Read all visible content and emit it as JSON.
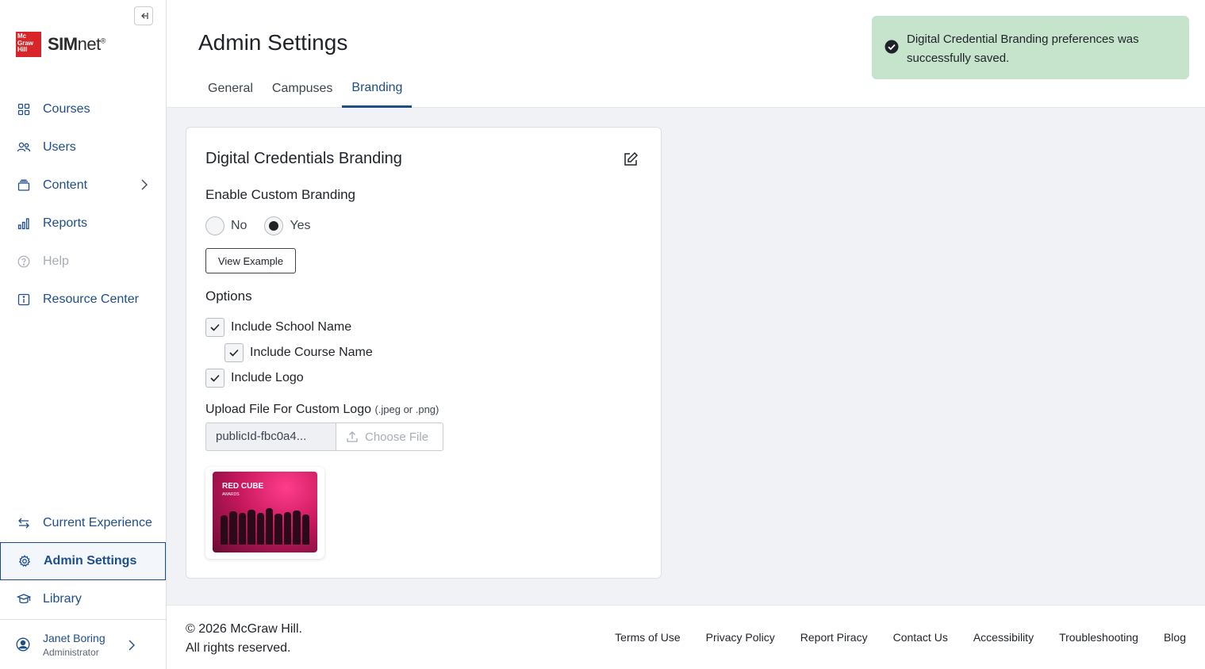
{
  "sidebar": {
    "logo_badge": "Mc Graw Hill",
    "logo_bold": "SIM",
    "logo_light": "net",
    "logo_mark": "®",
    "top_items": [
      {
        "label": "Courses",
        "icon": "grid-icon"
      },
      {
        "label": "Users",
        "icon": "users-icon"
      },
      {
        "label": "Content",
        "icon": "content-icon"
      },
      {
        "label": "Reports",
        "icon": "reports-icon"
      },
      {
        "label": "Help",
        "icon": "help-icon"
      },
      {
        "label": "Resource Center",
        "icon": "info-icon"
      }
    ],
    "bottom_items": [
      {
        "label": "Current Experience",
        "icon": "switch-icon"
      },
      {
        "label": "Admin Settings",
        "icon": "gear-icon"
      },
      {
        "label": "Library",
        "icon": "library-icon"
      }
    ],
    "user": {
      "name": "Janet Boring",
      "role": "Administrator"
    }
  },
  "header": {
    "title": "Admin Settings",
    "tabs": [
      {
        "label": "General"
      },
      {
        "label": "Campuses"
      },
      {
        "label": "Branding"
      }
    ],
    "active_tab": "Branding"
  },
  "card": {
    "title": "Digital Credentials Branding",
    "enable_label": "Enable Custom Branding",
    "radio_no": "No",
    "radio_yes": "Yes",
    "selected": "Yes",
    "view_example": "View Example",
    "options_label": "Options",
    "options": {
      "school_name": "Include School Name",
      "course_name": "Include Course Name",
      "logo": "Include Logo"
    },
    "upload_label": "Upload File For Custom Logo",
    "upload_hint": "(.jpeg or .png)",
    "file_name": "publicId-fbc0a4...",
    "choose_file": "Choose File",
    "thumb_text_line1": "RED CUBE",
    "thumb_text_line2": "AWARDS"
  },
  "toast": {
    "message": "Digital Credential Branding preferences was successfully saved."
  },
  "footer": {
    "copyright_line1": "© 2026 McGraw Hill.",
    "copyright_line2": "All rights reserved.",
    "links": [
      "Terms of Use",
      "Privacy Policy",
      "Report Piracy",
      "Contact Us",
      "Accessibility",
      "Troubleshooting",
      "Blog"
    ]
  },
  "colors": {
    "brand_blue": "#1d4e8a",
    "toast_bg": "#c6e4cc",
    "logo_red": "#d7252a"
  }
}
